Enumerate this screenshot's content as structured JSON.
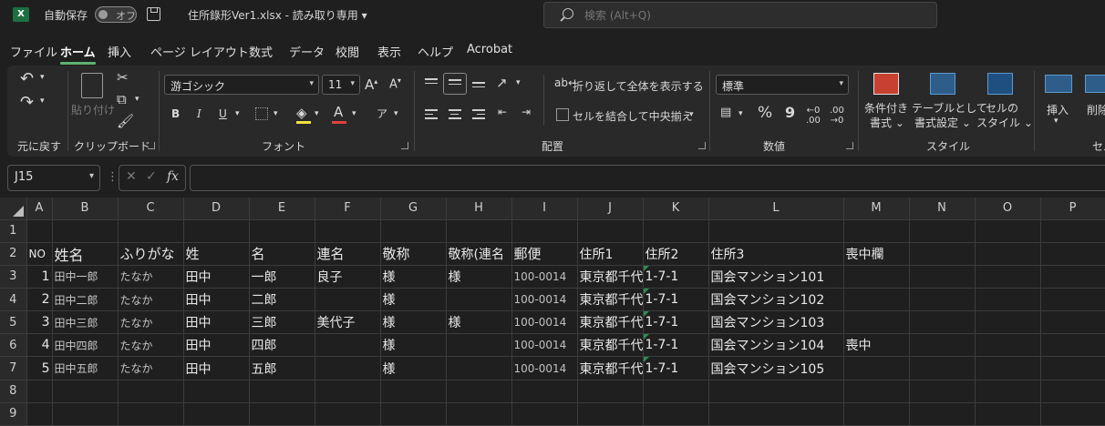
{
  "titlebar": {
    "app_letter": "X",
    "autosave_label": "自動保存",
    "autosave_state": "オフ",
    "filename": "住所錄形Ver1.xlsx  -  読み取り専用 ▾",
    "search_placeholder": "検索 (Alt+Q)"
  },
  "tabs": [
    "ファイル",
    "ホーム",
    "挿入",
    "ページ レイアウト",
    "数式",
    "データ",
    "校閲",
    "表示",
    "ヘルプ",
    "Acrobat"
  ],
  "active_tab": "ホーム",
  "ribbon": {
    "undo_group": "元に戻す",
    "clipboard": {
      "label": "クリップボード",
      "paste": "貼り付け"
    },
    "font": {
      "label": "フォント",
      "name": "游ゴシック",
      "size": "11",
      "bold": "B",
      "italic": "I",
      "underline": "U"
    },
    "alignment": {
      "label": "配置",
      "wrap": "折り返して全体を表示する",
      "merge": "セルを結合して中央揃え"
    },
    "number": {
      "label": "数値",
      "format": "標準",
      "percent": "%",
      "comma": "9"
    },
    "styles": {
      "label": "スタイル",
      "conditional": "条件付き書式",
      "conditional_1": "条件付き",
      "conditional_2": "書式 ⌄",
      "table_1": "テーブルとして",
      "table_2": "書式設定 ⌄",
      "cell_1": "セルの",
      "cell_2": "スタイル ⌄"
    },
    "cells": {
      "label": "セル",
      "insert": "挿入",
      "delete": "削除"
    }
  },
  "formula_bar": {
    "name_box": "J15",
    "fx": "fx",
    "formula": ""
  },
  "grid": {
    "columns": [
      "A",
      "B",
      "C",
      "D",
      "E",
      "F",
      "G",
      "H",
      "I",
      "J",
      "K",
      "L",
      "M",
      "N",
      "O",
      "P"
    ],
    "row_numbers": [
      "1",
      "2",
      "3",
      "4",
      "5",
      "6",
      "7",
      "8",
      "9"
    ],
    "header_row": [
      "NO",
      "姓名",
      "ふりがな",
      "姓",
      "名",
      "連名",
      "敬称",
      "敬称(連名",
      "郵便",
      "住所1",
      "住所2",
      "住所3",
      "喪中欄"
    ],
    "rows": [
      [
        "1",
        "田中一郎",
        "たなか",
        "田中",
        "一郎",
        "良子",
        "様",
        "様",
        "100-0014",
        "東京都千代",
        "1-7-1",
        "国会マンション101",
        ""
      ],
      [
        "2",
        "田中二郎",
        "たなか",
        "田中",
        "二郎",
        "",
        "様",
        "",
        "100-0014",
        "東京都千代",
        "1-7-1",
        "国会マンション102",
        ""
      ],
      [
        "3",
        "田中三郎",
        "たなか",
        "田中",
        "三郎",
        "美代子",
        "様",
        "様",
        "100-0014",
        "東京都千代",
        "1-7-1",
        "国会マンション103",
        ""
      ],
      [
        "4",
        "田中四郎",
        "たなか",
        "田中",
        "四郎",
        "",
        "様",
        "",
        "100-0014",
        "東京都千代",
        "1-7-1",
        "国会マンション104",
        "喪中"
      ],
      [
        "5",
        "田中五郎",
        "たなか",
        "田中",
        "五郎",
        "",
        "様",
        "",
        "100-0014",
        "東京都千代",
        "1-7-1",
        "国会マンション105",
        ""
      ]
    ]
  },
  "colors": {
    "accent": "#5fb070",
    "excel_green": "#1d6f42",
    "background": "#1f1f1f"
  }
}
